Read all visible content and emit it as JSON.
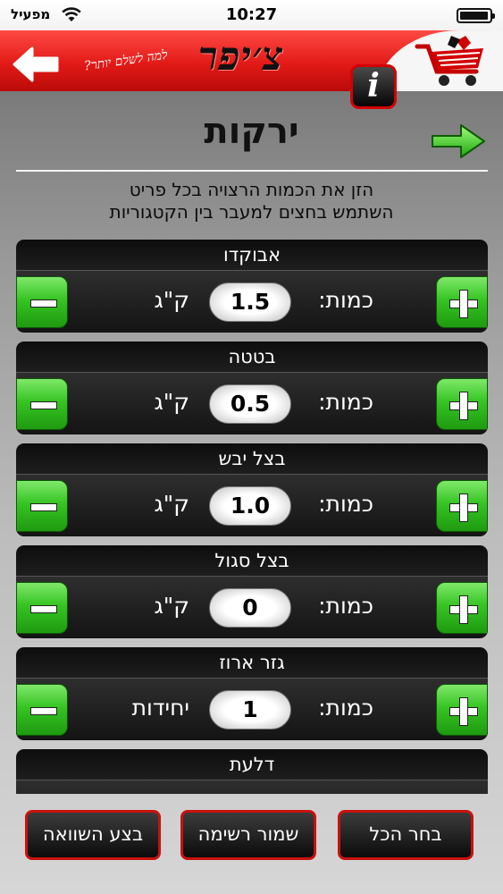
{
  "status_bar": {
    "carrier": "מפעיל",
    "time": "10:27"
  },
  "header": {
    "brand": "צ׳יפר",
    "tagline": "למה לשלם יותר?",
    "info_label": "i"
  },
  "page": {
    "title": "ירקות",
    "instructions_line1": "הזן את הכמות הרצויה בכל פריט",
    "instructions_line2": "השתמש בחצים למעבר בין הקטגוריות"
  },
  "quantity_label": "כמות:",
  "items": [
    {
      "name": "אבוקדו",
      "quantity": "1.5",
      "unit": "ק\"ג"
    },
    {
      "name": "בטטה",
      "quantity": "0.5",
      "unit": "ק\"ג"
    },
    {
      "name": "בצל יבש",
      "quantity": "1.0",
      "unit": "ק\"ג"
    },
    {
      "name": "בצל סגול",
      "quantity": "0",
      "unit": "ק\"ג"
    },
    {
      "name": "גזר ארוז",
      "quantity": "1",
      "unit": "יחידות"
    },
    {
      "name": "דלעת",
      "quantity": "",
      "unit": ""
    }
  ],
  "bottom_buttons": {
    "select_all": "בחר הכל",
    "save_list": "שמור רשימה",
    "compare": "בצע השוואה"
  },
  "colors": {
    "header_red": "#e21a17",
    "button_green": "#36c423",
    "button_border_red": "#c8120e"
  },
  "icons": {
    "back": "arrow-left-icon",
    "forward": "arrow-right-icon",
    "info": "info-icon",
    "logo": "shopping-cart-logo",
    "increase": "plus-icon",
    "decrease": "minus-icon"
  }
}
